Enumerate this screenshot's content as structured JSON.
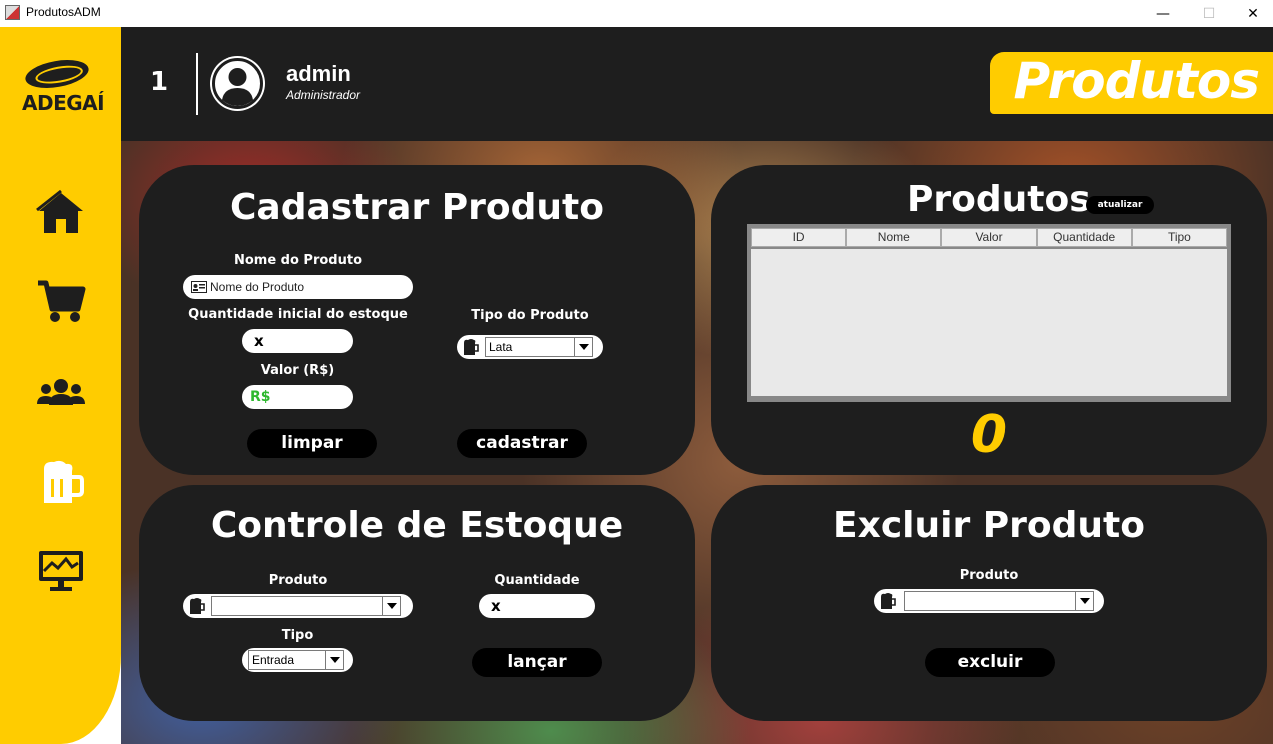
{
  "window": {
    "title": "ProdutosADM",
    "minimize": "—",
    "maximize": "☐",
    "close": "✕"
  },
  "brand": {
    "logo_text": "ADEGAÍ",
    "color": "#ffcc00"
  },
  "sidebar": {
    "items": [
      {
        "icon": "home-icon"
      },
      {
        "icon": "cart-icon"
      },
      {
        "icon": "users-icon"
      },
      {
        "icon": "beer-mug-icon"
      },
      {
        "icon": "monitor-chart-icon"
      }
    ]
  },
  "header": {
    "user_number": "1",
    "user_name": "admin",
    "user_role": "Administrador",
    "page_title": "Produtos"
  },
  "cadastrar": {
    "title": "Cadastrar Produto",
    "nome_label": "Nome do Produto",
    "nome_placeholder": "Nome do Produto",
    "quantidade_label": "Quantidade inicial do estoque",
    "quantidade_value": "x",
    "tipo_label": "Tipo do Produto",
    "tipo_value": "Lata",
    "valor_label": "Valor (R$)",
    "valor_value": "R$",
    "limpar_button": "limpar",
    "cadastrar_button": "cadastrar"
  },
  "produtos": {
    "title": "Produtos",
    "refresh_button": "atualizar",
    "columns": [
      "ID",
      "Nome",
      "Valor",
      "Quantidade",
      "Tipo"
    ],
    "rows": [],
    "count": "0"
  },
  "estoque": {
    "title": "Controle de Estoque",
    "produto_label": "Produto",
    "produto_value": "",
    "quantidade_label": "Quantidade",
    "quantidade_value": "x",
    "tipo_label": "Tipo",
    "tipo_value": "Entrada",
    "lancar_button": "lançar"
  },
  "excluir": {
    "title": "Excluir Produto",
    "produto_label": "Produto",
    "produto_value": "",
    "excluir_button": "excluir"
  }
}
